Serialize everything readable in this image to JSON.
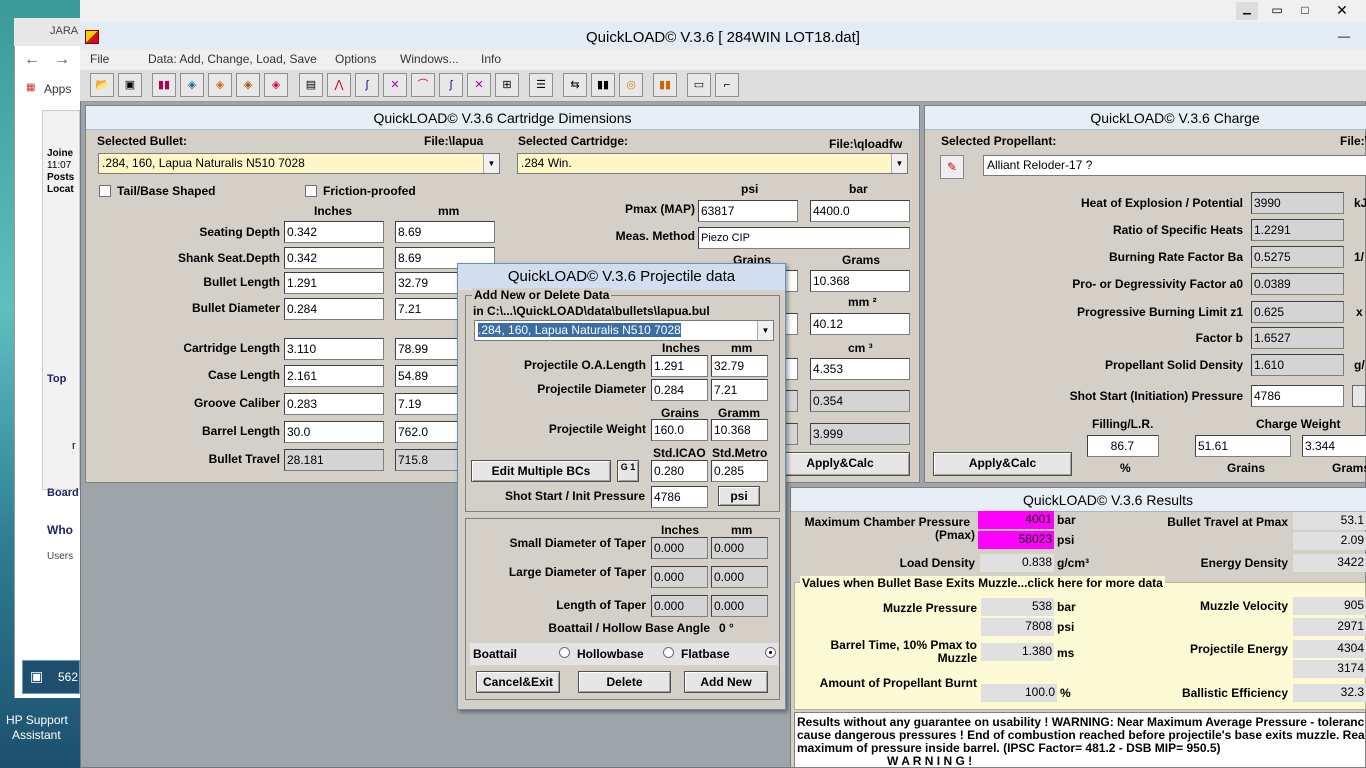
{
  "browser": {
    "tab": "JARA",
    "apps": "Apps",
    "joined": "Joine",
    "time": "11:07",
    "posts": "Posts",
    "locat": "Locat",
    "top": "Top",
    "board": "Board",
    "who": "Who",
    "users": "Users",
    "n562": "562",
    "r": "r"
  },
  "desktop": {
    "hp_line1": "HP Support",
    "hp_line2": "Assistant"
  },
  "app": {
    "title": "QuickLOAD© V.3.6   [ 284WIN LOT18.dat]"
  },
  "menu": [
    "File",
    "Data: Add, Change, Load, Save",
    "Options",
    "Windows...",
    "Info"
  ],
  "cart": {
    "title": "QuickLOAD© V.3.6 Cartridge Dimensions",
    "selected_bullet": "Selected Bullet:",
    "bullet_file": "File:\\lapua",
    "selected_cartridge": "Selected Cartridge:",
    "cart_file": "File:\\qloadfw",
    "bullet": ".284, 160, Lapua Naturalis N510 7028",
    "cartridge": ".284 Win.",
    "tail": "Tail/Base Shaped",
    "friction": "Friction-proofed",
    "inches": "Inches",
    "mm": "mm",
    "psi": "psi",
    "bar": "bar",
    "rows": [
      {
        "label": "Seating Depth",
        "in": "0.342",
        "mm": "8.69"
      },
      {
        "label": "Shank Seat.Depth",
        "in": "0.342",
        "mm": "8.69"
      },
      {
        "label": "Bullet Length",
        "in": "1.291",
        "mm": "32.79"
      },
      {
        "label": "Bullet Diameter",
        "in": "0.284",
        "mm": "7.21"
      },
      {
        "label": "Cartridge Length",
        "in": "3.110",
        "mm": "78.99"
      },
      {
        "label": "Case Length",
        "in": "2.161",
        "mm": "54.89"
      },
      {
        "label": "Groove Caliber",
        "in": "0.283",
        "mm": "7.19"
      },
      {
        "label": "Barrel Length",
        "in": "30.0",
        "mm": "762.0"
      },
      {
        "label": "Bullet Travel",
        "in": "28.181",
        "mm": "715.8"
      }
    ],
    "pmax_label": "Pmax (MAP)",
    "pmax_psi": "63817",
    "pmax_bar": "4400.0",
    "meas_label": "Meas. Method",
    "meas": "Piezo CIP",
    "grains": "Grains",
    "grams": "Grams",
    "grams_val": "10.368",
    "mm2": "mm ²",
    "mm2_val": "40.12",
    "cm3": "cm ³",
    "cm3_val": "4.353",
    "v1": "0.354",
    "v2": "3.999",
    "apply": "Apply&Calc"
  },
  "proj": {
    "title": "QuickLOAD© V.3.6 Projectile data",
    "group": "Add New or Delete Data",
    "path": "in  C:\\...\\QuickLOAD\\data\\bullets\\lapua.bul",
    "bullet": ".284, 160, Lapua Naturalis N510 7028",
    "inches": "Inches",
    "mm": "mm",
    "oal_label": "Projectile O.A.Length",
    "oal_in": "1.291",
    "oal_mm": "32.79",
    "dia_label": "Projectile Diameter",
    "dia_in": "0.284",
    "dia_mm": "7.21",
    "grains": "Grains",
    "gramm": "Gramm",
    "wt_label": "Projectile Weight",
    "wt_gr": "160.0",
    "wt_g": "10.368",
    "std_icao": "Std.ICAO",
    "std_metro": "Std.Metro",
    "edit_bc": "Edit Multiple BCs",
    "g1": "G 1",
    "bc_icao": "0.280",
    "bc_metro": "0.285",
    "shot_label": "Shot Start / Init Pressure",
    "shot": "4786",
    "psi_btn": "psi",
    "taper_small": "Small Diameter of Taper",
    "taper_large": "Large Diameter of Taper",
    "taper_len": "Length of Taper",
    "zero": "0.000",
    "angle_label": "Boattail / Hollow Base Angle",
    "angle": "0 °",
    "boattail": "Boattail",
    "hollowbase": "Hollowbase",
    "flatbase": "Flatbase",
    "cancel": "Cancel&Exit",
    "delete": "Delete",
    "addnew": "Add New"
  },
  "charge": {
    "title": "QuickLOAD© V.3.6 Charge",
    "selected": "Selected Propellant:",
    "file": "File:\\",
    "propellant": "Alliant Reloder-17 ?",
    "rows": [
      {
        "label": "Heat of Explosion / Potential",
        "val": "3990",
        "unit": "kJ"
      },
      {
        "label": "Ratio of Specific Heats",
        "val": "1.2291",
        "unit": ""
      },
      {
        "label": "Burning Rate Factor  Ba",
        "val": "0.5275",
        "unit": "1/"
      },
      {
        "label": "Pro- or Degressivity Factor  a0",
        "val": "0.0389",
        "unit": ""
      },
      {
        "label": "Progressive Burning Limit z1",
        "val": "0.625",
        "unit": "x"
      },
      {
        "label": "Factor  b",
        "val": "1.6527",
        "unit": ""
      },
      {
        "label": "Propellant Solid Density",
        "val": "1.610",
        "unit": "g/"
      }
    ],
    "shot_label": "Shot Start (Initiation) Pressure",
    "shot": "4786",
    "filling": "Filling/L.R.",
    "charge_weight": "Charge Weight",
    "fill_val": "86.7",
    "grains_val": "51.61",
    "grams_val": "3.344",
    "pct": "%",
    "grains": "Grains",
    "grams": "Grams",
    "apply": "Apply&Calc"
  },
  "results": {
    "title": "QuickLOAD© V.3.6 Results",
    "max_label": "Maximum Chamber Pressure",
    "pmax_label": "(Pmax)",
    "bar_val": "4001",
    "bar": "bar",
    "psi_val": "58023",
    "psi": "psi",
    "travel_label": "Bullet Travel at Pmax",
    "travel1": "53.1",
    "travel2": "2.09",
    "load_label": "Load Density",
    "load_val": "0.838",
    "load_unit": "g/cm³",
    "energy_label": "Energy Density",
    "energy_val": "3422",
    "exit_header": "Values when Bullet Base Exits Muzzle...click here for more data",
    "mp_label": "Muzzle Pressure",
    "mp_bar": "538",
    "mp_bar_u": "bar",
    "mp_psi": "7808",
    "mp_psi_u": "psi",
    "mv_label": "Muzzle Velocity",
    "mv1": "905",
    "mv2": "2971",
    "bt_label1": "Barrel Time, 10% Pmax to",
    "bt_label2": "Muzzle",
    "bt_val": "1.380",
    "bt_unit": "ms",
    "pe_label": "Projectile Energy",
    "pe1": "4304",
    "pe2": "3174",
    "ab_label": "Amount of Propellant Burnt",
    "ab_val": "100.0",
    "ab_unit": "%",
    "be_label": "Ballistic Efficiency",
    "be_val": "32.3",
    "warn1": "Results without any guarantee on usability !  WARNING: Near Maximum Average Pressure - toleranc",
    "warn2": "cause dangerous pressures !  End of combustion reached before projectile's base exits muzzle.  Rea",
    "warn3": "maximum of pressure inside barrel.  (IPSC Factor= 481.2 - DSB MIP= 950.5)",
    "warn4": "W A R N I N G !"
  }
}
